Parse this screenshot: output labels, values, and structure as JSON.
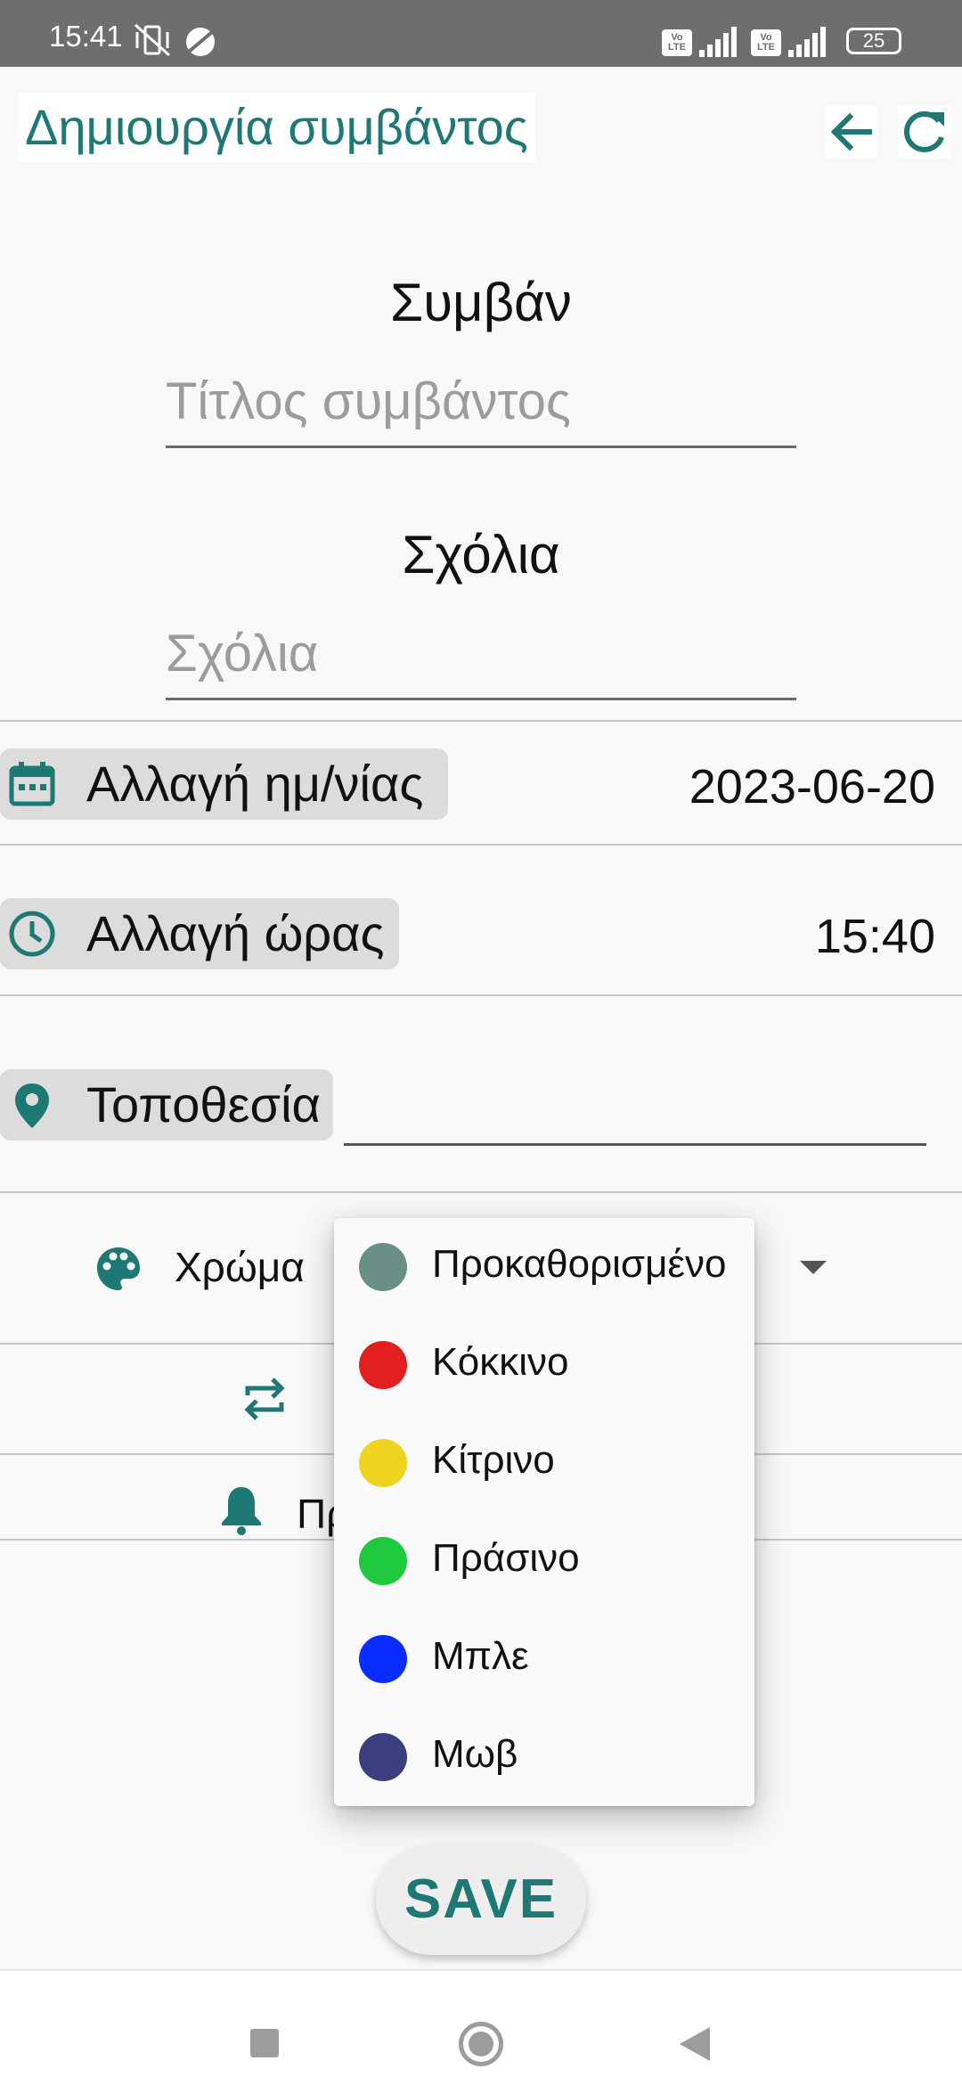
{
  "status_bar": {
    "time": "15:41",
    "battery": "25",
    "volte_1": "Vo LTE",
    "volte_2": "Vo LTE"
  },
  "app_bar": {
    "title": "Δημιουργία συμβάντος",
    "back_icon": "arrow-back-icon",
    "refresh_icon": "refresh-icon"
  },
  "form": {
    "event_label": "Συμβάν",
    "event_title_placeholder": "Τίτλος συμβάντος",
    "comments_label": "Σχόλια",
    "comments_placeholder": "Σχόλια",
    "date_button": "Αλλαγή ημ/νίας",
    "date_value": "2023-06-20",
    "time_button": "Αλλαγή ώρας",
    "time_value": "15:40",
    "location_button": "Τοποθεσία",
    "location_value": "",
    "color_label": "Χρώμα",
    "reminder_label_partial": "Πρ"
  },
  "color_dropdown": {
    "options": [
      {
        "label": "Προκαθορισμένο",
        "color": "#6a8f86"
      },
      {
        "label": "Κόκκινο",
        "color": "#e21f1f"
      },
      {
        "label": "Κίτρινο",
        "color": "#eed41e"
      },
      {
        "label": "Πράσινο",
        "color": "#1ec93d"
      },
      {
        "label": "Μπλε",
        "color": "#0b2cff"
      },
      {
        "label": "Μωβ",
        "color": "#3b3f7f"
      }
    ]
  },
  "save_button": "SAVE",
  "accent_color": "#1e7873"
}
